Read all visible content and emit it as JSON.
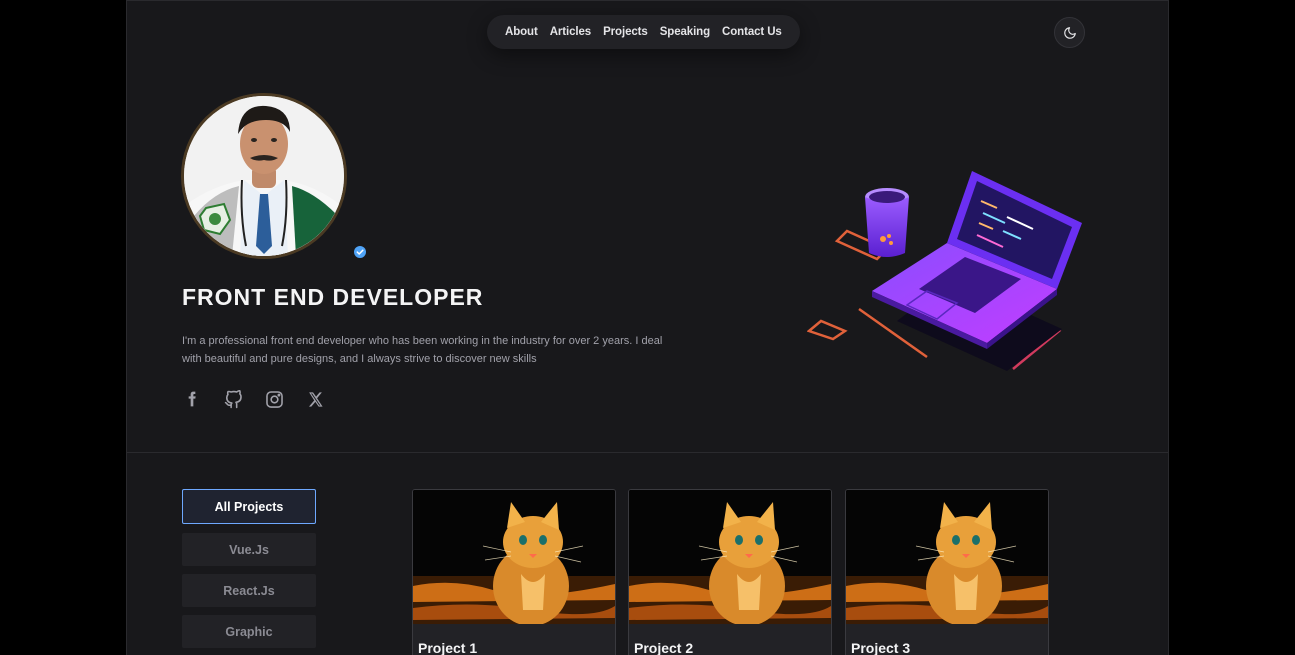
{
  "nav": {
    "items": [
      {
        "label": "About"
      },
      {
        "label": "Articles"
      },
      {
        "label": "Projects"
      },
      {
        "label": "Speaking"
      },
      {
        "label": "Contact Us"
      }
    ]
  },
  "hero": {
    "title": "FRONT END DEVELOPER",
    "description": "I'm a professional front end developer who has been working in the industry for over 2 years. I deal with beautiful and pure designs, and I always strive to discover new skills",
    "socials": [
      "facebook-icon",
      "github-icon",
      "instagram-icon",
      "x-icon"
    ]
  },
  "filters": [
    {
      "label": "All Projects",
      "active": true
    },
    {
      "label": "Vue.Js",
      "active": false
    },
    {
      "label": "React.Js",
      "active": false
    },
    {
      "label": "Graphic",
      "active": false
    }
  ],
  "projects": [
    {
      "title": "Project 1"
    },
    {
      "title": "Project 2"
    },
    {
      "title": "Project 3"
    }
  ],
  "colors": {
    "background": "#18181b",
    "accent": "#6ea8fe",
    "badge": "#4fa3f7"
  }
}
